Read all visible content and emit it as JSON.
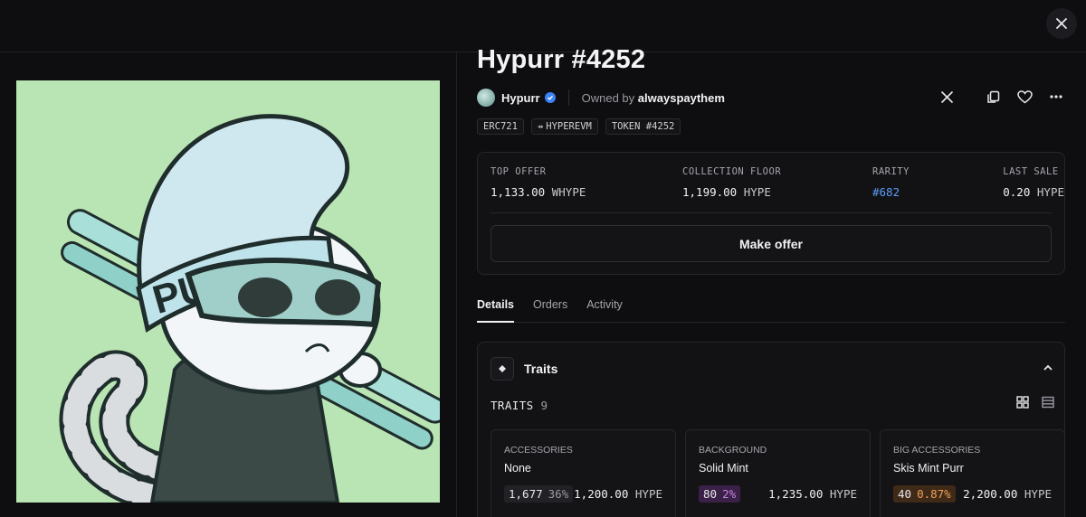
{
  "nft": {
    "title": "Hypurr #4252",
    "collection": "Hypurr",
    "owned_prefix": "Owned by",
    "owner": "alwayspaythem",
    "tags": [
      "ERC721",
      "HYPEREVM",
      "TOKEN #4252"
    ]
  },
  "stats": {
    "top_offer": {
      "label": "TOP OFFER",
      "amount": "1,133.00",
      "unit": "WHYPE"
    },
    "collection_floor": {
      "label": "COLLECTION FLOOR",
      "amount": "1,199.00",
      "unit": "HYPE"
    },
    "rarity": {
      "label": "RARITY",
      "value": "#682"
    },
    "last_sale": {
      "label": "LAST SALE",
      "amount": "0.20",
      "unit": "HYPE"
    },
    "make_offer_label": "Make offer"
  },
  "tabs": [
    "Details",
    "Orders",
    "Activity"
  ],
  "traits": {
    "title": "Traits",
    "count_label": "TRAITS",
    "count": "9",
    "items": [
      {
        "type": "ACCESSORIES",
        "name": "None",
        "count": "1,677",
        "pct": "36%",
        "price": "1,200.00",
        "unit": "HYPE",
        "pill_bg": "#222226",
        "pct_color": "#9a9aa2"
      },
      {
        "type": "BACKGROUND",
        "name": "Solid Mint",
        "count": "80",
        "pct": "2%",
        "price": "1,235.00",
        "unit": "HYPE",
        "pill_bg": "#3b2148",
        "pct_color": "#c685e6"
      },
      {
        "type": "BIG ACCESSORIES",
        "name": "Skis Mint Purr",
        "count": "40",
        "pct": "0.87%",
        "price": "2,200.00",
        "unit": "HYPE",
        "pill_bg": "#3f2a18",
        "pct_color": "#f0a25a"
      }
    ]
  },
  "colors": {
    "accent_link": "#5b9cf6",
    "art_bg": "#b9e4b3",
    "verified": "#3b82f6"
  }
}
